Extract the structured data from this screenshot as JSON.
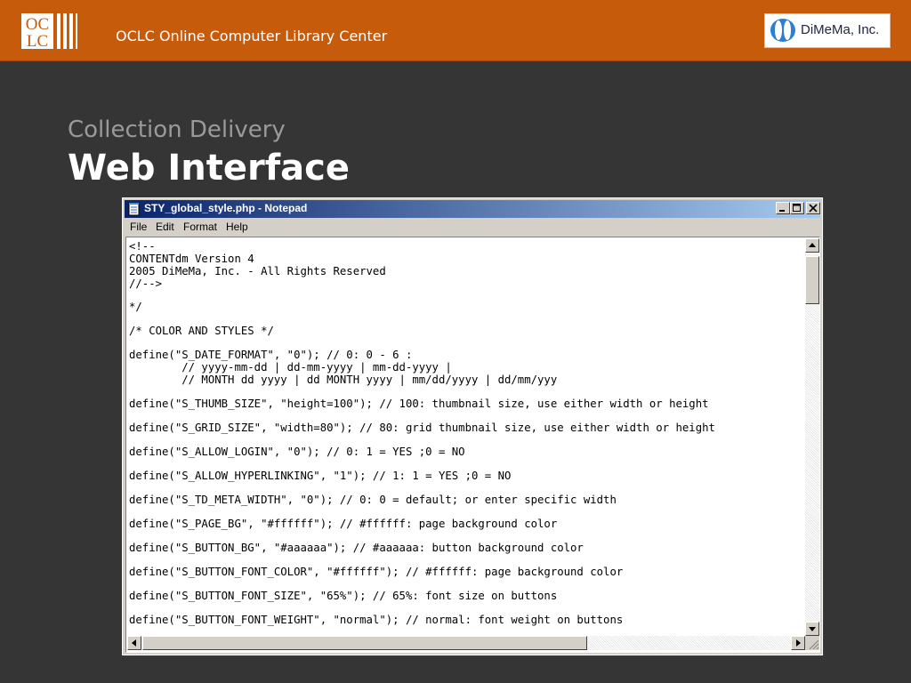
{
  "header": {
    "logo_line1": "OC",
    "logo_line2": "LC",
    "org_name": "OCLC Online Computer Library Center",
    "partner_logo_text": "DiMeMa, Inc."
  },
  "slide": {
    "subtitle": "Collection Delivery",
    "title": "Web Interface"
  },
  "window": {
    "title": "STY_global_style.php - Notepad",
    "menu": [
      "File",
      "Edit",
      "Format",
      "Help"
    ],
    "controls": [
      "minimize-icon",
      "maximize-icon",
      "close-icon"
    ]
  },
  "editor": {
    "lines": [
      "<!--",
      "CONTENTdm Version 4",
      "2005 DiMeMa, Inc. - All Rights Reserved",
      "//-->",
      "",
      "*/",
      "",
      "/* COLOR AND STYLES */",
      "",
      "define(\"S_DATE_FORMAT\", \"0\"); // 0: 0 - 6 :",
      "        // yyyy-mm-dd | dd-mm-yyyy | mm-dd-yyyy |",
      "        // MONTH dd yyyy | dd MONTH yyyy | mm/dd/yyyy | dd/mm/yyy",
      "",
      "define(\"S_THUMB_SIZE\", \"height=100\"); // 100: thumbnail size, use either width or height",
      "",
      "define(\"S_GRID_SIZE\", \"width=80\"); // 80: grid thumbnail size, use either width or height",
      "",
      "define(\"S_ALLOW_LOGIN\", \"0\"); // 0: 1 = YES ;0 = NO",
      "",
      "define(\"S_ALLOW_HYPERLINKING\", \"1\"); // 1: 1 = YES ;0 = NO",
      "",
      "define(\"S_TD_META_WIDTH\", \"0\"); // 0: 0 = default; or enter specific width",
      "",
      "define(\"S_PAGE_BG\", \"#ffffff\"); // #ffffff: page background color",
      "",
      "define(\"S_BUTTON_BG\", \"#aaaaaa\"); // #aaaaaa: button background color",
      "",
      "define(\"S_BUTTON_FONT_COLOR\", \"#ffffff\"); // #ffffff: page background color",
      "",
      "define(\"S_BUTTON_FONT_SIZE\", \"65%\"); // 65%: font size on buttons",
      "",
      "define(\"S_BUTTON_FONT_WEIGHT\", \"normal\"); // normal: font weight on buttons"
    ]
  },
  "colors": {
    "header_bg": "#c75b0c",
    "slide_bg": "#353535",
    "titlebar_start": "#0a246a",
    "titlebar_end": "#a6caf0"
  }
}
